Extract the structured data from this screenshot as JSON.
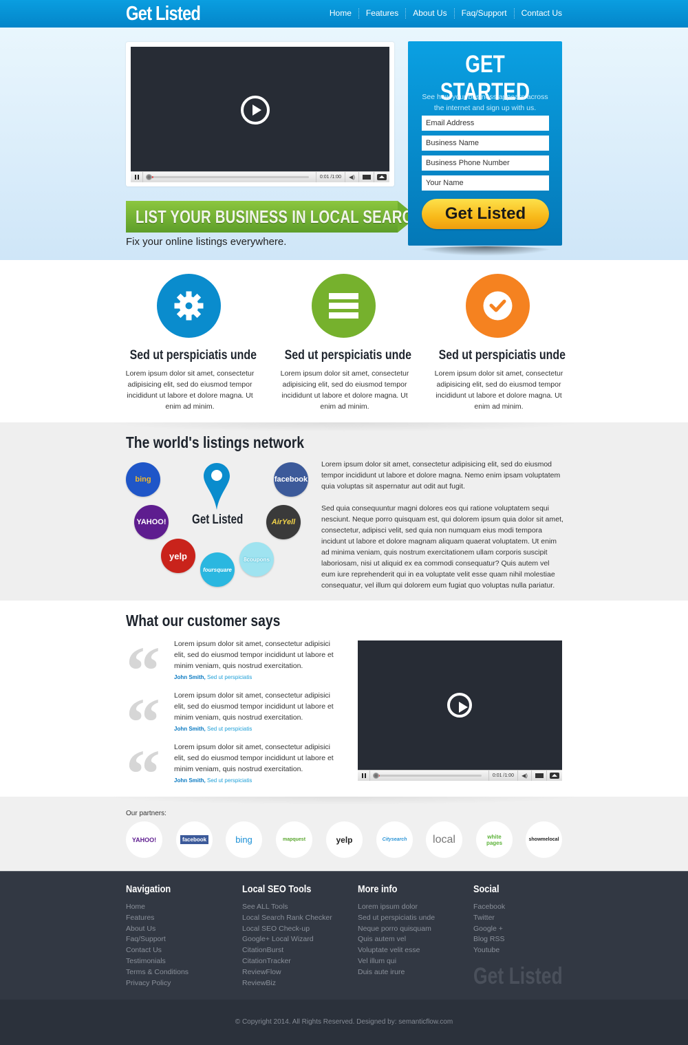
{
  "header": {
    "logo": "Get Listed",
    "nav": [
      "Home",
      "Features",
      "About Us",
      "Faq/Support",
      "Contact Us"
    ]
  },
  "hero": {
    "video": {
      "time": "0:01 /1:00",
      "progress": 0.02
    },
    "banner": "LIST YOUR BUSINESS IN LOCAL SEARCH",
    "subtitle": "Fix your online listings everywhere.",
    "signup": {
      "title": "GET STARTED",
      "description": "See how your business appears across the internet and sign up with us.",
      "fields": [
        {
          "placeholder": "Email Address"
        },
        {
          "placeholder": "Business Name"
        },
        {
          "placeholder": "Business Phone Number"
        },
        {
          "placeholder": "Your Name"
        }
      ],
      "button": "Get Listed"
    }
  },
  "features": [
    {
      "icon": "gear-icon",
      "color": "#0a8ccd",
      "title": "Sed ut perspiciatis unde",
      "text": "Lorem ipsum dolor sit amet, consectetur adipisicing elit, sed do eiusmod tempor incididunt ut labore et dolore magna. Ut enim ad minim."
    },
    {
      "icon": "list-icon",
      "color": "#76b12d",
      "title": "Sed ut perspiciatis unde",
      "text": "Lorem ipsum dolor sit amet, consectetur adipisicing elit, sed do eiusmod tempor incididunt ut labore et dolore magna. Ut enim ad minim."
    },
    {
      "icon": "check-circle-icon",
      "color": "#f58220",
      "title": "Sed ut perspiciatis unde",
      "text": "Lorem ipsum dolor sit amet, consectetur adipisicing elit, sed do eiusmod tempor incididunt ut labore et dolore magna. Ut enim ad minim."
    }
  ],
  "network": {
    "title": "The world's listings network",
    "center_label": "Get Listed",
    "logos": [
      {
        "name": "bing",
        "label": "bing",
        "color": "#1f56c8"
      },
      {
        "name": "facebook",
        "label": "facebook",
        "color": "#3c5a9a"
      },
      {
        "name": "yahoo",
        "label": "YAHOO!",
        "color": "#5e1d8f"
      },
      {
        "name": "airyell",
        "label": "AirYell",
        "color": "#3a3a3a"
      },
      {
        "name": "yelp",
        "label": "yelp",
        "color": "#c9231b"
      },
      {
        "name": "foursquare",
        "label": "foursquare",
        "color": "#2ab7e0"
      },
      {
        "name": "8coupons",
        "label": "8coupons",
        "color": "#9fe3f0"
      }
    ],
    "paragraphs": [
      "Lorem ipsum dolor sit amet, consectetur adipisicing elit, sed do eiusmod tempor incididunt ut labore et dolore magna. Nemo enim ipsam voluptatem quia voluptas sit aspernatur aut odit aut fugit.",
      "Sed quia consequuntur magni dolores eos qui ratione voluptatem sequi nesciunt. Neque porro quisquam est, qui dolorem ipsum quia dolor sit amet, consectetur, adipisci velit, sed quia non numquam eius modi tempora incidunt ut labore et dolore magnam aliquam quaerat voluptatem. Ut enim ad minima veniam, quis nostrum exercitationem ullam corporis suscipit laboriosam, nisi ut aliquid ex ea commodi consequatur? Quis autem vel eum iure reprehenderit qui in ea voluptate velit esse quam nihil molestiae consequatur, vel illum qui dolorem eum fugiat quo voluptas nulla pariatur."
    ]
  },
  "testimonials": {
    "title": "What our customer says",
    "items": [
      {
        "text": "Lorem ipsum dolor sit amet, consectetur adipisici elit, sed do eiusmod tempor incididunt ut labore et minim veniam, quis nostrud exercitation.",
        "name": "John Smith,",
        "role": "Sed ut perspiciatis"
      },
      {
        "text": "Lorem ipsum dolor sit amet, consectetur adipisici elit, sed do eiusmod tempor incididunt ut labore et minim veniam, quis nostrud exercitation.",
        "name": "John Smith,",
        "role": "Sed ut perspiciatis"
      },
      {
        "text": "Lorem ipsum dolor sit amet, consectetur adipisici elit, sed do eiusmod tempor incididunt ut labore et minim veniam, quis nostrud exercitation.",
        "name": "John Smith,",
        "role": "Sed ut perspiciatis"
      }
    ],
    "video": {
      "time": "0:01 /1:00",
      "progress": 0.02
    }
  },
  "partners": {
    "label": "Our partners:",
    "items": [
      {
        "name": "yahoo",
        "label": "YAHOO!",
        "color": "#5e1d8f"
      },
      {
        "name": "facebook",
        "label": "facebook",
        "color": "#3c5a9a"
      },
      {
        "name": "bing",
        "label": "bing",
        "color": "#1a8fd6"
      },
      {
        "name": "mapquest",
        "label": "mapquest",
        "color": "#5aa62f"
      },
      {
        "name": "yelp",
        "label": "yelp",
        "color": "#c41200"
      },
      {
        "name": "citysearch",
        "label": "Citysearch",
        "color": "#2d95d6"
      },
      {
        "name": "local",
        "label": "local",
        "color": "#777777"
      },
      {
        "name": "whitepages",
        "label": "white pages",
        "color": "#5db33a"
      },
      {
        "name": "showmelocal",
        "label": "showmelocal",
        "color": "#222222"
      }
    ]
  },
  "footer": {
    "columns": [
      {
        "title": "Navigation",
        "links": [
          "Home",
          "Features",
          "About Us",
          "Faq/Support",
          "Contact Us",
          "Testimonials",
          "Terms & Conditions",
          "Privacy Policy"
        ]
      },
      {
        "title": "Local SEO Tools",
        "links": [
          "See ALL Tools",
          "Local Search Rank Checker",
          "Local SEO Check-up",
          "Google+ Local Wizard",
          "CitationBurst",
          "CitationTracker",
          "ReviewFlow",
          "ReviewBiz"
        ]
      },
      {
        "title": "More info",
        "links": [
          "Lorem ipsum dolor",
          "Sed ut perspiciatis unde",
          "Neque porro quisquam",
          "Quis autem vel",
          "Voluptate velit esse",
          "Vel illum qui",
          "Duis aute irure"
        ]
      },
      {
        "title": "Social",
        "links": [
          "Facebook",
          "Twitter",
          "Google +",
          "Blog RSS",
          "Youtube"
        ]
      }
    ],
    "logo": "Get Listed",
    "copyright": "© Copyright 2014. All Rights Reserved. Designed by: semanticflow.com"
  }
}
